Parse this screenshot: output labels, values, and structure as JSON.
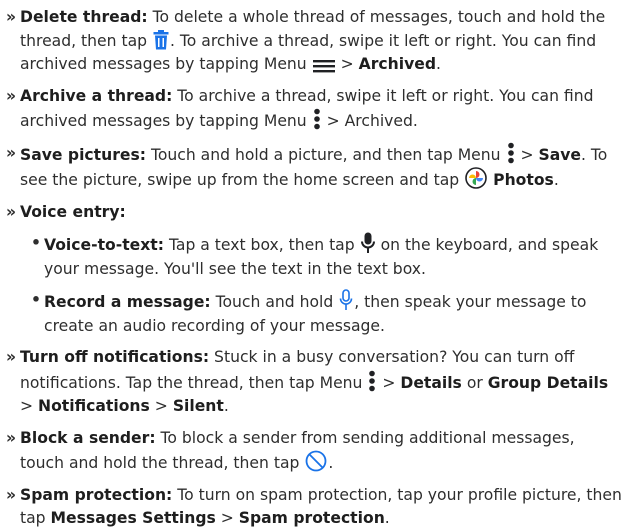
{
  "bullet_marker": "»",
  "sub_marker": "•",
  "items": {
    "delete": {
      "title": "Delete thread:",
      "t1": " To delete a whole thread of messages, touch and hold the thread, then tap ",
      "t2": ". To archive a thread, swipe it left or right. You can find archived messages by tapping Menu ",
      "t3": " > ",
      "b1": "Archived",
      "t4": "."
    },
    "archive": {
      "title": "Archive a thread:",
      "t1": " To archive a thread, swipe it left or right. You can find archived messages by tapping Menu ",
      "t2": " > Archived."
    },
    "save": {
      "title": "Save pictures:",
      "t1": " Touch and hold a picture, and then tap Menu ",
      "t2": " > ",
      "b1": "Save",
      "t3": ". To see the picture, swipe up from the home screen and tap ",
      "b2": "Photos",
      "t4": "."
    },
    "voice": {
      "title": "Voice entry:"
    },
    "voice_to_text": {
      "title": "Voice-to-text:",
      "t1": " Tap a text box, then tap ",
      "t2": " on the keyboard, and speak your message. You'll see the text in the text box."
    },
    "record": {
      "title": "Record a message:",
      "t1": " Touch and hold ",
      "t2": ", then speak your message to create an audio recording of your message."
    },
    "notifications": {
      "title": "Turn off notifications:",
      "t1": " Stuck in a busy conversation? You can turn off notifications. Tap the thread, then tap Menu ",
      "t2": " > ",
      "b1": "Details",
      "t3": " or ",
      "b2": "Group Details",
      "t4": " > ",
      "b3": "Notifications",
      "t5": " > ",
      "b4": "Silent",
      "t6": "."
    },
    "block": {
      "title": "Block a sender:",
      "t1": " To block a sender from sending additional messages, touch and hold the thread, then tap ",
      "t2": "."
    },
    "spam": {
      "title": "Spam protection:",
      "t1": " To turn on spam protection, tap your profile picture, then tap ",
      "b1": "Messages Settings",
      "t2": " > ",
      "b2": "Spam protection",
      "t3": "."
    }
  },
  "colors": {
    "text": "#2e2e2e",
    "icon_blue": "#1a73e8",
    "icon_dark": "#202124"
  }
}
